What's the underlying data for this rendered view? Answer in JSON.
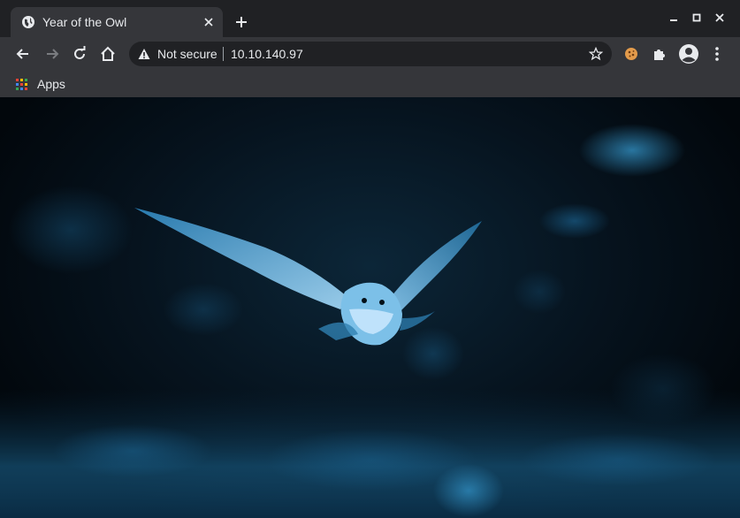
{
  "tab": {
    "title": "Year of the Owl",
    "favicon": "globe-icon"
  },
  "toolbar": {
    "security_label": "Not secure",
    "url": "10.10.140.97"
  },
  "bookmarks": {
    "apps_label": "Apps"
  },
  "colors": {
    "frame": "#202124",
    "toolbar": "#35363a",
    "text": "#e8eaed",
    "accent_blue": "#2f8fc6"
  }
}
